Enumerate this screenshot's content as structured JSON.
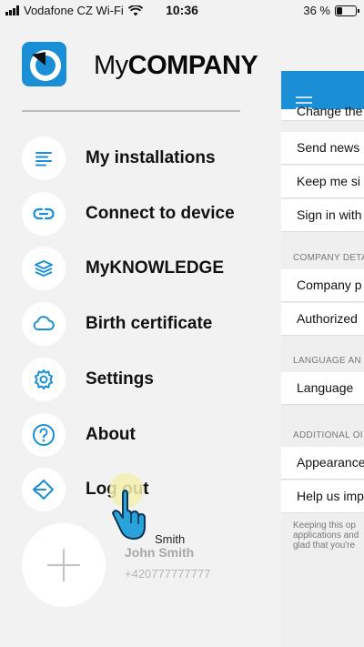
{
  "status_bar": {
    "carrier": "Vodafone CZ Wi-Fi",
    "time": "10:36",
    "battery": "36 %"
  },
  "app": {
    "brand_light": "My",
    "brand_bold": "COMPANY",
    "accent": "#1a8fd6"
  },
  "menu": {
    "items": [
      {
        "label": "My installations",
        "icon": "list-icon"
      },
      {
        "label": "Connect to device",
        "icon": "link-icon"
      },
      {
        "label": "MyKNOWLEDGE",
        "icon": "layers-icon"
      },
      {
        "label": "Birth certificate",
        "icon": "cloud-icon"
      },
      {
        "label": "Settings",
        "icon": "gear-icon"
      },
      {
        "label": "About",
        "icon": "help-icon"
      },
      {
        "label": "Log out",
        "icon": "logout-icon"
      }
    ]
  },
  "profile": {
    "tooltip_name": "Smith",
    "name": "John Smith",
    "phone": "+420777777777"
  },
  "settings_panel": {
    "rows": [
      "Change the",
      "Send news",
      "Keep me si",
      "Sign in with",
      "Company p",
      "Authorized",
      "Language",
      "Appearance",
      "Help us imp"
    ],
    "sections": [
      "COMPANY DETA",
      "LANGUAGE AN",
      "ADDITIONAL OI"
    ],
    "footnote": [
      "Keeping this op",
      "applications and",
      "glad that you're"
    ]
  }
}
